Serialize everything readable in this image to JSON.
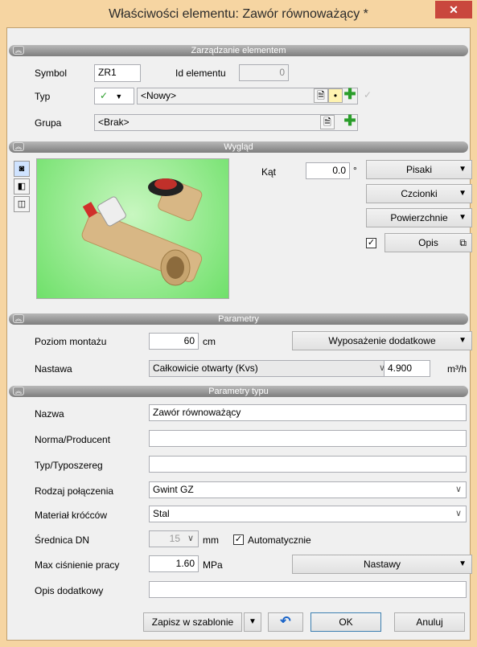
{
  "window": {
    "title": "Właściwości elementu: Zawór równoważący *",
    "close_glyph": "✕"
  },
  "sections": {
    "management": "Zarządzanie elementem",
    "appearance": "Wygląd",
    "params": "Parametry",
    "type_params": "Parametry typu"
  },
  "management": {
    "symbol_label": "Symbol",
    "symbol_value": "ZR1",
    "id_label": "Id elementu",
    "id_value": "0",
    "type_label": "Typ",
    "type_value": "<Nowy>",
    "group_label": "Grupa",
    "group_value": "<Brak>"
  },
  "appearance": {
    "angle_label": "Kąt",
    "angle_value": "0.0",
    "angle_unit": "°",
    "pens": "Pisaki",
    "fonts": "Czcionki",
    "surfaces": "Powierzchnie",
    "desc_button": "Opis"
  },
  "params": {
    "mount_label": "Poziom montażu",
    "mount_value": "60",
    "mount_unit": "cm",
    "extra_equipment": "Wyposażenie dodatkowe",
    "setting_label": "Nastawa",
    "setting_value": "Całkowicie otwarty (Kvs)",
    "kvs_value": "4.900",
    "kvs_unit": "m³/h"
  },
  "type_params": {
    "name_label": "Nazwa",
    "name_value": "Zawór równoważący",
    "norm_label": "Norma/Producent",
    "norm_value": "",
    "series_label": "Typ/Typoszereg",
    "series_value": "",
    "conn_label": "Rodzaj połączenia",
    "conn_value": "Gwint GZ",
    "material_label": "Materiał króćców",
    "material_value": "Stal",
    "dn_label": "Średnica DN",
    "dn_value": "15",
    "dn_unit": "mm",
    "auto_label": "Automatycznie",
    "pressure_label": "Max ciśnienie pracy",
    "pressure_value": "1.60",
    "pressure_unit": "MPa",
    "settings_button": "Nastawy",
    "extra_desc_label": "Opis dodatkowy",
    "extra_desc_value": ""
  },
  "footer": {
    "save_template": "Zapisz w szablonie",
    "ok": "OK",
    "cancel": "Anuluj"
  },
  "icons": {
    "check": "✓",
    "arrow": "▼",
    "combo": "∨",
    "plus": "✚",
    "undo": "↶"
  }
}
